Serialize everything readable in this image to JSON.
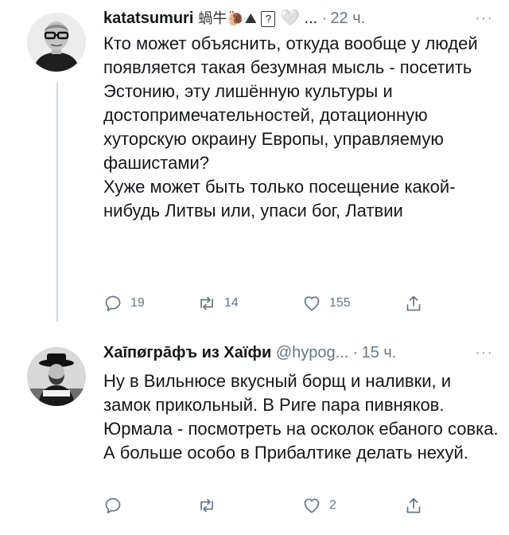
{
  "tweets": [
    {
      "display_name": "katatsumuri",
      "name_emojis": "蝸牛🐌⛰",
      "box_glyph": "?",
      "heart_glyph": "🤍",
      "ellipsis": "...",
      "separator": "·",
      "time": "22 ч.",
      "more": "···",
      "text_lines": [
        "Кто может объяснить, откуда вообще у людей появляется такая безумная мысль - посетить Эстонию, эту лишённую культуры и достопримечательностей, дотационную хуторскую окраину Европы, управляемую фашистами?",
        "Хуже может быть только посещение какой-нибудь Литвы или, упаси бог, Латвии"
      ],
      "replies": "19",
      "retweets": "14",
      "likes": "155",
      "icons": [
        "reply-icon",
        "retweet-icon",
        "like-icon",
        "share-icon"
      ]
    },
    {
      "display_name": "Хаīпøгрāфъ из Хаїфи",
      "handle": "@hypog...",
      "separator": "·",
      "time": "15 ч.",
      "more": "···",
      "text_lines": [
        "Ну в Вильнюсе вкусный борщ и наливки, и замок прикольный. В Риге пара пивняков. Юрмала - посмотреть на осколок ебаного совка. А больше особо в Прибалтике делать нехуй."
      ],
      "replies": "",
      "retweets": "",
      "likes": "2",
      "icons": [
        "reply-icon",
        "retweet-icon",
        "like-icon",
        "share-icon"
      ]
    }
  ],
  "colors": {
    "text": "#14171a",
    "muted": "#657786",
    "thread_line": "#ccd6dd",
    "background": "#ffffff"
  }
}
